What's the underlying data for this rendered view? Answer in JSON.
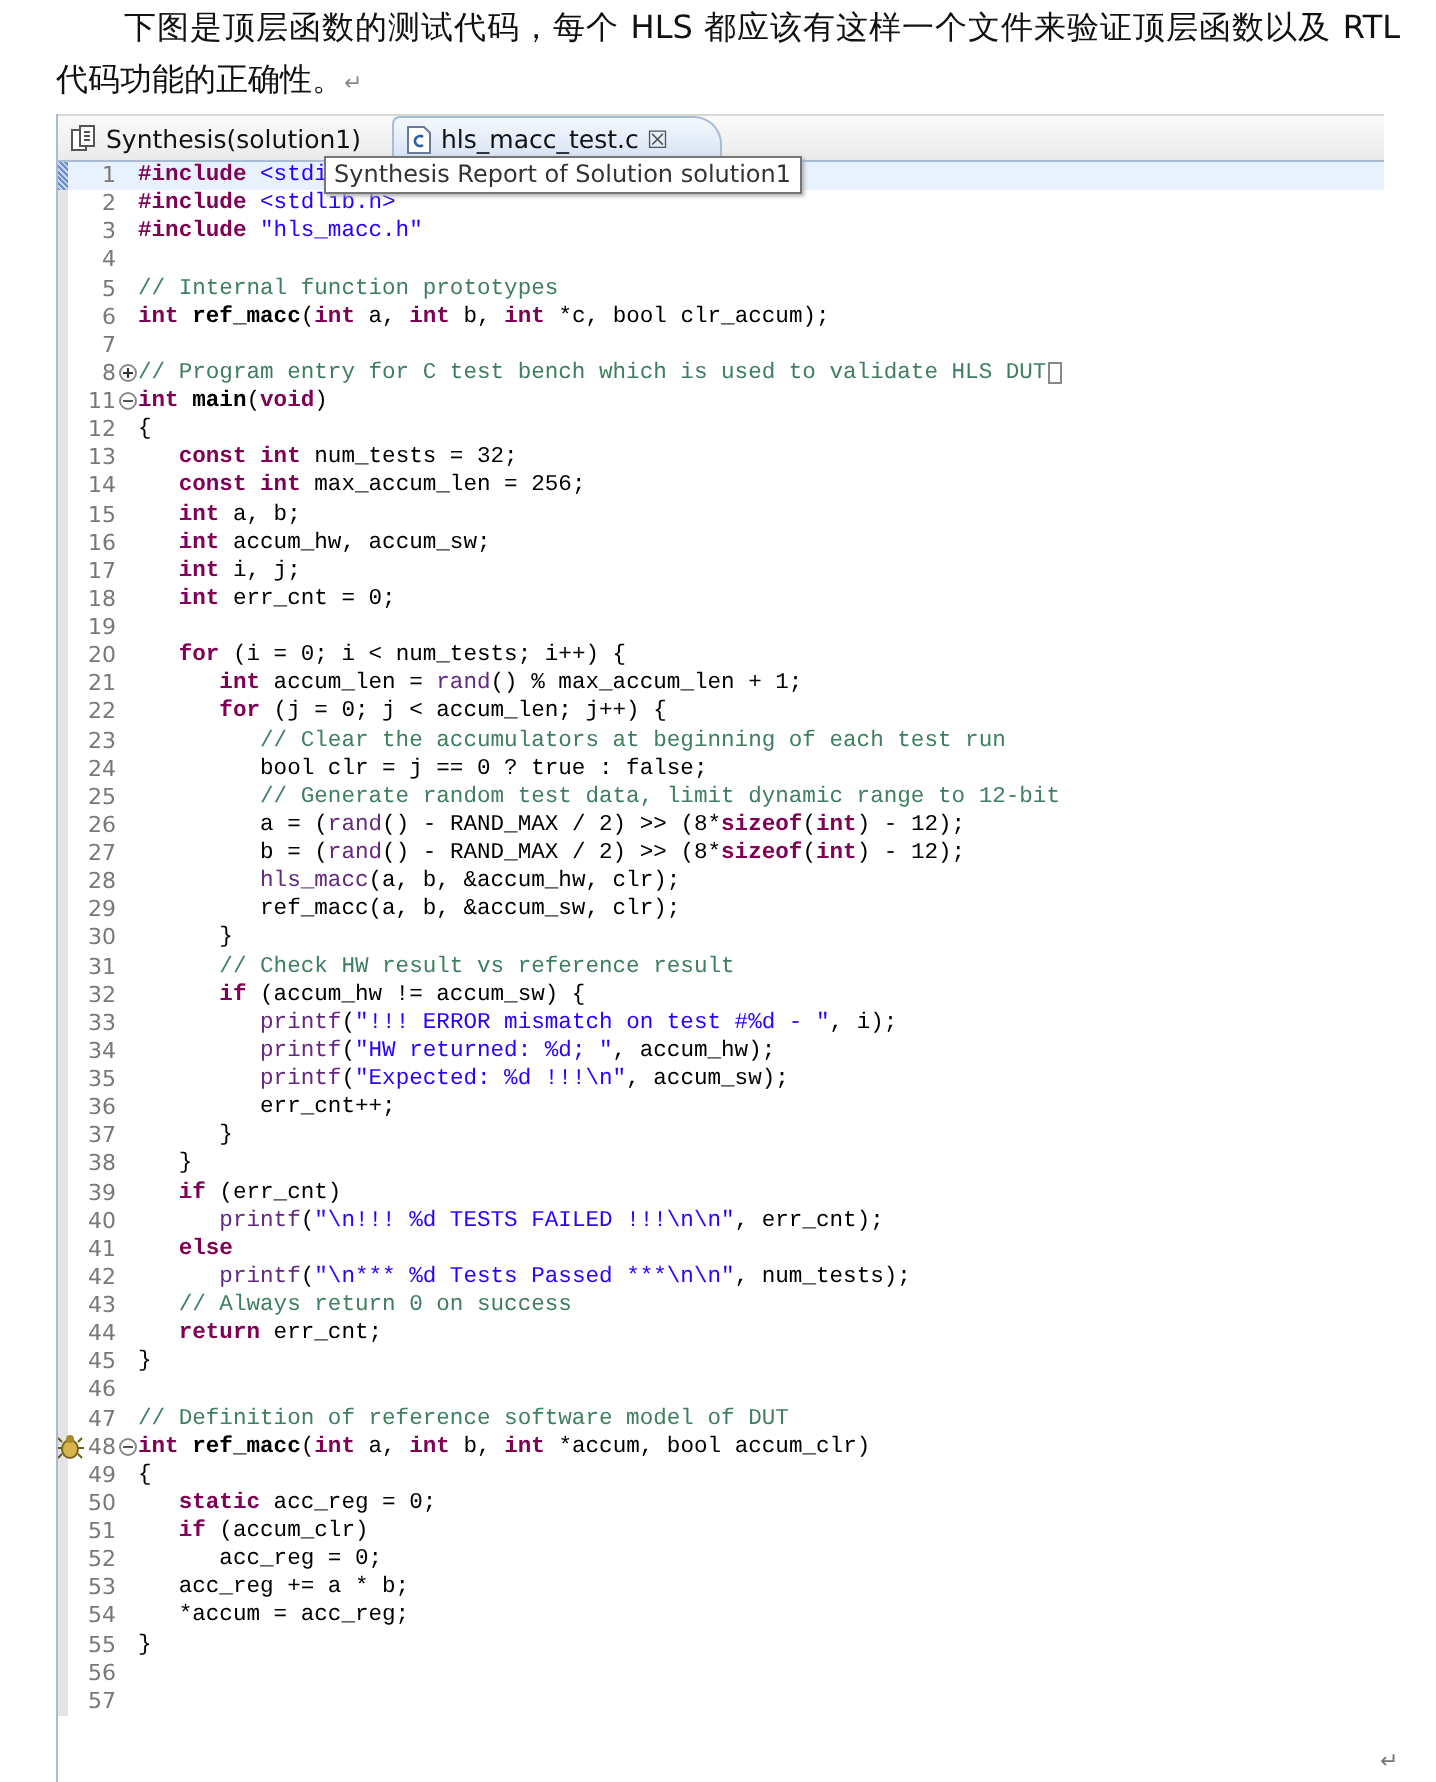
{
  "paragraph": {
    "text": "下图是顶层函数的测试代码，每个 HLS 都应该有这样一个文件来验证顶层函数以及 RTL 代码功能的正确性。",
    "mark": "↵"
  },
  "editor": {
    "tabs": [
      {
        "label": "Synthesis(solution1)",
        "kind": "report",
        "selected": false
      },
      {
        "label": "hls_macc_test.c",
        "kind": "source",
        "selected": true,
        "close": "☒"
      }
    ],
    "tooltip": "Synthesis Report of Solution solution1",
    "lines": [
      {
        "number": "1",
        "current": true,
        "tokens": [
          {
            "kind": "kw",
            "text": "#include"
          },
          {
            "kind": "str",
            "text": " <stdi"
          }
        ]
      },
      {
        "number": "2",
        "tokens": [
          {
            "kind": "kw",
            "text": "#include"
          },
          {
            "kind": "str",
            "text": " <stdlib.h>"
          }
        ]
      },
      {
        "number": "3",
        "tokens": [
          {
            "kind": "kw",
            "text": "#include"
          },
          {
            "kind": "str",
            "text": " \"hls_macc.h\""
          }
        ]
      },
      {
        "number": "4"
      },
      {
        "number": "5",
        "tokens": [
          {
            "kind": "cmt",
            "text": "// Internal function prototypes"
          }
        ]
      },
      {
        "number": "6",
        "tokens": [
          {
            "kind": "kw",
            "text": "int"
          },
          {
            "kind": "fn",
            "text": " ref_macc"
          },
          {
            "kind": "txt",
            "text": "("
          },
          {
            "kind": "kw",
            "text": "int"
          },
          {
            "kind": "txt",
            "text": " a, "
          },
          {
            "kind": "kw",
            "text": "int"
          },
          {
            "kind": "txt",
            "text": " b, "
          },
          {
            "kind": "kw",
            "text": "int"
          },
          {
            "kind": "txt",
            "text": " *c, bool clr_accum);"
          }
        ]
      },
      {
        "number": "7"
      },
      {
        "number": "8",
        "expanded": false,
        "folded": true,
        "tokens": [
          {
            "kind": "cmt",
            "text": "// Program entry for C test bench which is used to validate HLS DUT"
          }
        ]
      },
      {
        "number": "11",
        "expanded": true,
        "tokens": [
          {
            "kind": "kw",
            "text": "int"
          },
          {
            "kind": "fn",
            "text": " main"
          },
          {
            "kind": "txt",
            "text": "("
          },
          {
            "kind": "kw",
            "text": "void"
          },
          {
            "kind": "txt",
            "text": ")"
          }
        ]
      },
      {
        "number": "12",
        "tokens": [
          {
            "kind": "txt",
            "text": "{"
          }
        ]
      },
      {
        "number": "13",
        "tokens": [
          {
            "kind": "kw",
            "text": "   const int"
          },
          {
            "kind": "txt",
            "text": " num_tests = 32;"
          }
        ]
      },
      {
        "number": "14",
        "tokens": [
          {
            "kind": "kw",
            "text": "   const int"
          },
          {
            "kind": "txt",
            "text": " max_accum_len = 256;"
          }
        ]
      },
      {
        "number": "15",
        "tokens": [
          {
            "kind": "kw",
            "text": "   int"
          },
          {
            "kind": "txt",
            "text": " a, b;"
          }
        ]
      },
      {
        "number": "16",
        "tokens": [
          {
            "kind": "kw",
            "text": "   int"
          },
          {
            "kind": "txt",
            "text": " accum_hw, accum_sw;"
          }
        ]
      },
      {
        "number": "17",
        "tokens": [
          {
            "kind": "kw",
            "text": "   int"
          },
          {
            "kind": "txt",
            "text": " i, j;"
          }
        ]
      },
      {
        "number": "18",
        "tokens": [
          {
            "kind": "kw",
            "text": "   int"
          },
          {
            "kind": "txt",
            "text": " err_cnt = 0;"
          }
        ]
      },
      {
        "number": "19"
      },
      {
        "number": "20",
        "tokens": [
          {
            "kind": "kw",
            "text": "   for"
          },
          {
            "kind": "txt",
            "text": " (i = 0; i < num_tests; i++) {"
          }
        ]
      },
      {
        "number": "21",
        "tokens": [
          {
            "kind": "kw",
            "text": "      int"
          },
          {
            "kind": "txt",
            "text": " accum_len = "
          },
          {
            "kind": "call",
            "text": "rand"
          },
          {
            "kind": "txt",
            "text": "() % max_accum_len + 1;"
          }
        ]
      },
      {
        "number": "22",
        "tokens": [
          {
            "kind": "kw",
            "text": "      for"
          },
          {
            "kind": "txt",
            "text": " (j = 0; j < accum_len; j++) {"
          }
        ]
      },
      {
        "number": "23",
        "tokens": [
          {
            "kind": "cmt",
            "text": "         // Clear the accumulators at beginning of each test run"
          }
        ]
      },
      {
        "number": "24",
        "tokens": [
          {
            "kind": "txt",
            "text": "         bool clr = j == 0 ? true : false;"
          }
        ]
      },
      {
        "number": "25",
        "tokens": [
          {
            "kind": "cmt",
            "text": "         // Generate random test data, limit dynamic range to 12-bit"
          }
        ]
      },
      {
        "number": "26",
        "tokens": [
          {
            "kind": "txt",
            "text": "         a = ("
          },
          {
            "kind": "call",
            "text": "rand"
          },
          {
            "kind": "txt",
            "text": "() - RAND_MAX / 2) >> (8*"
          },
          {
            "kind": "kw",
            "text": "sizeof"
          },
          {
            "kind": "txt",
            "text": "("
          },
          {
            "kind": "kw",
            "text": "int"
          },
          {
            "kind": "txt",
            "text": ") - 12);"
          }
        ]
      },
      {
        "number": "27",
        "tokens": [
          {
            "kind": "txt",
            "text": "         b = ("
          },
          {
            "kind": "call",
            "text": "rand"
          },
          {
            "kind": "txt",
            "text": "() - RAND_MAX / 2) >> (8*"
          },
          {
            "kind": "kw",
            "text": "sizeof"
          },
          {
            "kind": "txt",
            "text": "("
          },
          {
            "kind": "kw",
            "text": "int"
          },
          {
            "kind": "txt",
            "text": ") - 12);"
          }
        ]
      },
      {
        "number": "28",
        "tokens": [
          {
            "kind": "call",
            "text": "         hls_macc"
          },
          {
            "kind": "txt",
            "text": "(a, b, &accum_hw, clr);"
          }
        ]
      },
      {
        "number": "29",
        "tokens": [
          {
            "kind": "txt",
            "text": "         ref_macc(a, b, &accum_sw, clr);"
          }
        ]
      },
      {
        "number": "30",
        "tokens": [
          {
            "kind": "txt",
            "text": "      }"
          }
        ]
      },
      {
        "number": "31",
        "tokens": [
          {
            "kind": "cmt",
            "text": "      // Check HW result vs reference result"
          }
        ]
      },
      {
        "number": "32",
        "tokens": [
          {
            "kind": "kw",
            "text": "      if"
          },
          {
            "kind": "txt",
            "text": " (accum_hw != accum_sw) {"
          }
        ]
      },
      {
        "number": "33",
        "tokens": [
          {
            "kind": "call",
            "text": "         printf"
          },
          {
            "kind": "txt",
            "text": "("
          },
          {
            "kind": "str",
            "text": "\"!!! ERROR mismatch on test #%d - \""
          },
          {
            "kind": "txt",
            "text": ", i);"
          }
        ]
      },
      {
        "number": "34",
        "tokens": [
          {
            "kind": "call",
            "text": "         printf"
          },
          {
            "kind": "txt",
            "text": "("
          },
          {
            "kind": "str",
            "text": "\"HW returned: %d; \""
          },
          {
            "kind": "txt",
            "text": ", accum_hw);"
          }
        ]
      },
      {
        "number": "35",
        "tokens": [
          {
            "kind": "call",
            "text": "         printf"
          },
          {
            "kind": "txt",
            "text": "("
          },
          {
            "kind": "str",
            "text": "\"Expected: %d !!!\\n\""
          },
          {
            "kind": "txt",
            "text": ", accum_sw);"
          }
        ]
      },
      {
        "number": "36",
        "tokens": [
          {
            "kind": "txt",
            "text": "         err_cnt++;"
          }
        ]
      },
      {
        "number": "37",
        "tokens": [
          {
            "kind": "txt",
            "text": "      }"
          }
        ]
      },
      {
        "number": "38",
        "tokens": [
          {
            "kind": "txt",
            "text": "   }"
          }
        ]
      },
      {
        "number": "39",
        "tokens": [
          {
            "kind": "kw",
            "text": "   if"
          },
          {
            "kind": "txt",
            "text": " (err_cnt)"
          }
        ]
      },
      {
        "number": "40",
        "tokens": [
          {
            "kind": "call",
            "text": "      printf"
          },
          {
            "kind": "txt",
            "text": "("
          },
          {
            "kind": "str",
            "text": "\"\\n!!! %d TESTS FAILED !!!\\n\\n\""
          },
          {
            "kind": "txt",
            "text": ", err_cnt);"
          }
        ]
      },
      {
        "number": "41",
        "tokens": [
          {
            "kind": "kw",
            "text": "   else"
          }
        ]
      },
      {
        "number": "42",
        "tokens": [
          {
            "kind": "call",
            "text": "      printf"
          },
          {
            "kind": "txt",
            "text": "("
          },
          {
            "kind": "str",
            "text": "\"\\n*** %d Tests Passed ***\\n\\n\""
          },
          {
            "kind": "txt",
            "text": ", num_tests);"
          }
        ]
      },
      {
        "number": "43",
        "tokens": [
          {
            "kind": "cmt",
            "text": "   // Always return 0 on success"
          }
        ]
      },
      {
        "number": "44",
        "tokens": [
          {
            "kind": "kw",
            "text": "   return"
          },
          {
            "kind": "txt",
            "text": " err_cnt;"
          }
        ]
      },
      {
        "number": "45",
        "tokens": [
          {
            "kind": "txt",
            "text": "}"
          }
        ]
      },
      {
        "number": "46"
      },
      {
        "number": "47",
        "tokens": [
          {
            "kind": "cmt",
            "text": "// Definition of reference software model of DUT"
          }
        ]
      },
      {
        "number": "48",
        "expanded": true,
        "warning": true,
        "tokens": [
          {
            "kind": "kw",
            "text": "int"
          },
          {
            "kind": "fn",
            "text": " ref_macc"
          },
          {
            "kind": "txt",
            "text": "("
          },
          {
            "kind": "kw",
            "text": "int"
          },
          {
            "kind": "txt",
            "text": " a, "
          },
          {
            "kind": "kw",
            "text": "int"
          },
          {
            "kind": "txt",
            "text": " b, "
          },
          {
            "kind": "kw",
            "text": "int"
          },
          {
            "kind": "txt",
            "text": " *accum, bool accum_clr)"
          }
        ]
      },
      {
        "number": "49",
        "tokens": [
          {
            "kind": "txt",
            "text": "{"
          }
        ]
      },
      {
        "number": "50",
        "tokens": [
          {
            "kind": "kw",
            "text": "   static"
          },
          {
            "kind": "txt",
            "text": " acc_reg = 0;"
          }
        ]
      },
      {
        "number": "51",
        "tokens": [
          {
            "kind": "kw",
            "text": "   if"
          },
          {
            "kind": "txt",
            "text": " (accum_clr)"
          }
        ]
      },
      {
        "number": "52",
        "tokens": [
          {
            "kind": "txt",
            "text": "      acc_reg = 0;"
          }
        ]
      },
      {
        "number": "53",
        "tokens": [
          {
            "kind": "txt",
            "text": "   acc_reg += a * b;"
          }
        ]
      },
      {
        "number": "54",
        "tokens": [
          {
            "kind": "txt",
            "text": "   *accum = acc_reg;"
          }
        ]
      },
      {
        "number": "55",
        "tokens": [
          {
            "kind": "txt",
            "text": "}"
          }
        ]
      },
      {
        "number": "56"
      },
      {
        "number": "57"
      }
    ]
  },
  "end_mark": "↵"
}
